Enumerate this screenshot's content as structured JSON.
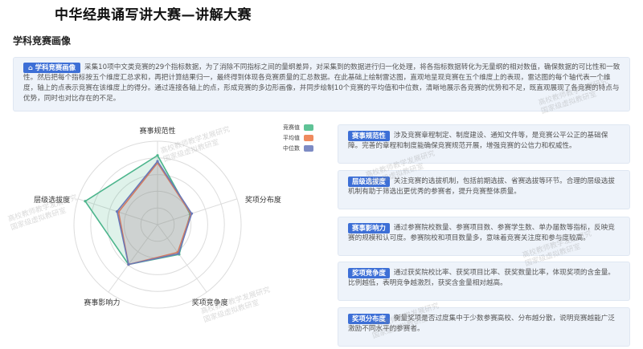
{
  "header": {
    "title": "中华经典诵写讲大赛—讲解大赛"
  },
  "section": {
    "title": "学科竞赛画像"
  },
  "intro": {
    "badge_icon": "home-icon",
    "badge": "学科竞赛画像",
    "text": "采集10项中文类竞赛的29个指标数据，为了消除不同指标之间的量纲差异，对采集到的数据进行归一化处理，将各指标数据转化为无量纲的相对数值，确保数据的可比性和一致性。然后把每个指标按五个维度汇总求和，再把计算结果归一，最终得到体现各竞赛质量的汇总数据。在此基础上绘制雷达图，直观地呈现竞赛在五个维度上的表现，雷达图的每个轴代表一个维度，轴上的点表示竞赛在该维度上的得分。通过连接各轴上的点，形成竞赛的多边形画像，并同步绘制10个竞赛的平均值和中位数，清晰地展示各竞赛的优势和不足，既直观展现了各竞赛的特点与优势，同时也对比存在的不足。"
  },
  "radar": {
    "axes": [
      "赛事规范性",
      "奖项分布度",
      "奖项竞争度",
      "赛事影响力",
      "层级选拔度"
    ],
    "max": 1,
    "rings": 5,
    "series": [
      {
        "name": "竞赛值",
        "color": "#4cb58c",
        "values": [
          0.83,
          0.41,
          0.44,
          0.59,
          0.91
        ]
      },
      {
        "name": "平均值",
        "color": "#e67d52",
        "values": [
          0.74,
          0.42,
          0.41,
          0.59,
          0.49
        ]
      },
      {
        "name": "中位数",
        "color": "#6a79b8",
        "values": [
          0.76,
          0.43,
          0.43,
          0.59,
          0.51
        ]
      }
    ]
  },
  "legend": {
    "items": [
      {
        "label": "竞赛值",
        "color": "#5fc396"
      },
      {
        "label": "平均值",
        "color": "#ef8a5e"
      },
      {
        "label": "中位数",
        "color": "#7d8bc4"
      }
    ]
  },
  "cards": [
    {
      "badge": "赛事规范性",
      "text": "涉及竞赛章程制定、制度建设、通知文件等，是竞赛公平公正的基础保障。完善的章程和制度能确保竞赛规范开展，增强竞赛的公信力和权威性。"
    },
    {
      "badge": "层级选拔度",
      "text": "关注竞赛的选拔机制，包括前期选拔、省赛选拔等环节。合理的层级选拔机制有助于筛选出更优秀的参赛者，提升竞赛整体质量。"
    },
    {
      "badge": "赛事影响力",
      "text": "通过参赛院校数量、参赛项目数、参赛学生数、单办届数等指标，反映竞赛的规模和认可度。参赛院校和项目数量多，意味着竞赛关注度和参与度较高。"
    },
    {
      "badge": "奖项竞争度",
      "text": "通过获奖院校比率、获奖项目比率、获奖数量比率，体现奖项的含金量。比例越低，表明竞争越激烈，获奖含金量相对越高。"
    },
    {
      "badge": "奖项分布度",
      "text": "衡量奖项是否过度集中于少数参赛高校、分布越分散，说明竞赛越能广泛激励不同水平的参赛者。"
    }
  ],
  "watermark": {
    "line1": "高校教师教学发展研究",
    "line2": "国家级虚拟教研室"
  }
}
